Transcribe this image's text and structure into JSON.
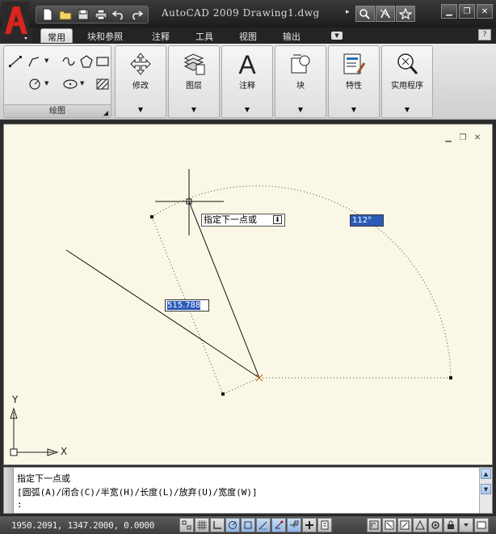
{
  "title": {
    "text": "AutoCAD 2009  Drawing1.dwg"
  },
  "tabs": [
    {
      "label": "常用"
    },
    {
      "label": "块和参照"
    },
    {
      "label": "注释"
    },
    {
      "label": "工具"
    },
    {
      "label": "视图"
    },
    {
      "label": "输出"
    }
  ],
  "help": {
    "label": "?"
  },
  "ribbon": {
    "draw_panel_label": "绘图",
    "panels": [
      {
        "label": "修改",
        "icon": "move-arrows-icon"
      },
      {
        "label": "图层",
        "icon": "layers-icon"
      },
      {
        "label": "注释",
        "icon": "annotation-a-icon"
      },
      {
        "label": "块",
        "icon": "block-icon"
      },
      {
        "label": "特性",
        "icon": "properties-icon"
      },
      {
        "label": "实用程序",
        "icon": "zoom-utility-icon"
      }
    ]
  },
  "drawing": {
    "tooltip_prompt": "指定下一点或",
    "angle_input": "112°",
    "length_input": "515.788",
    "ucs_x": "X",
    "ucs_y": "Y"
  },
  "command": {
    "line1": "指定下一点或",
    "line2": "[圆弧(A)/闭合(C)/半宽(H)/长度(L)/放弃(U)/宽度(W)]",
    "line3": ":"
  },
  "status": {
    "coordinates": "1950.2091,  1347.2000,  0.0000"
  },
  "colors": {
    "canvas_bg": "#fbf7e6",
    "dyn_input_bg": "#2b5bb8",
    "titlebar_bg": "#1c1c1c",
    "logo_red": "#c8201e"
  }
}
